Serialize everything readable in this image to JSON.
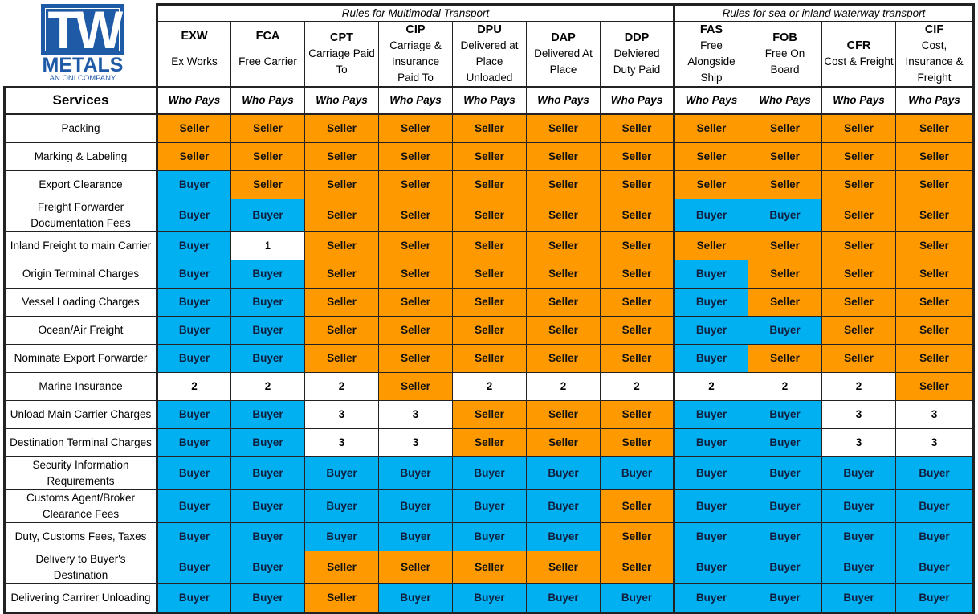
{
  "logo": {
    "mark": "TW",
    "name": "METALS",
    "tagline": "AN ONI COMPANY"
  },
  "groups": [
    {
      "label": "Rules for Multimodal Transport",
      "span": 7
    },
    {
      "label": "Rules for sea or inland waterway transport",
      "span": 4
    }
  ],
  "terms": [
    {
      "code": "EXW",
      "name": "Ex Works"
    },
    {
      "code": "FCA",
      "name": "Free Carrier"
    },
    {
      "code": "CPT",
      "name": "Carriage Paid To"
    },
    {
      "code": "CIP",
      "name": "Carriage & Insurance Paid To"
    },
    {
      "code": "DPU",
      "name": "Delivered at Place Unloaded"
    },
    {
      "code": "DAP",
      "name": "Delivered At Place"
    },
    {
      "code": "DDP",
      "name": "Delviered Duty Paid"
    },
    {
      "code": "FAS",
      "name": "Free Alongside Ship"
    },
    {
      "code": "FOB",
      "name": "Free On Board"
    },
    {
      "code": "CFR",
      "name": "Cost & Freight"
    },
    {
      "code": "CIF",
      "name": "Cost, Insurance & Freight"
    }
  ],
  "services_header": "Services",
  "who_pays_label": "Who Pays",
  "colors": {
    "seller": "#ff9900",
    "buyer": "#00b0f0",
    "blank": "#ffffff"
  },
  "rows": [
    {
      "service": "Packing",
      "values": [
        "Seller",
        "Seller",
        "Seller",
        "Seller",
        "Seller",
        "Seller",
        "Seller",
        "Seller",
        "Seller",
        "Seller",
        "Seller"
      ]
    },
    {
      "service": "Marking & Labeling",
      "values": [
        "Seller",
        "Seller",
        "Seller",
        "Seller",
        "Seller",
        "Seller",
        "Seller",
        "Seller",
        "Seller",
        "Seller",
        "Seller"
      ]
    },
    {
      "service": "Export Clearance",
      "values": [
        "Buyer",
        "Seller",
        "Seller",
        "Seller",
        "Seller",
        "Seller",
        "Seller",
        "Seller",
        "Seller",
        "Seller",
        "Seller"
      ]
    },
    {
      "service": "Freight Forwarder Documentation Fees",
      "values": [
        "Buyer",
        "Buyer",
        "Seller",
        "Seller",
        "Seller",
        "Seller",
        "Seller",
        "Buyer",
        "Buyer",
        "Seller",
        "Seller"
      ]
    },
    {
      "service": "Inland Freight to main Carrier",
      "values": [
        "Buyer",
        "1",
        "Seller",
        "Seller",
        "Seller",
        "Seller",
        "Seller",
        "Seller",
        "Seller",
        "Seller",
        "Seller"
      ]
    },
    {
      "service": "Origin Terminal Charges",
      "values": [
        "Buyer",
        "Buyer",
        "Seller",
        "Seller",
        "Seller",
        "Seller",
        "Seller",
        "Buyer",
        "Seller",
        "Seller",
        "Seller"
      ]
    },
    {
      "service": "Vessel Loading Charges",
      "values": [
        "Buyer",
        "Buyer",
        "Seller",
        "Seller",
        "Seller",
        "Seller",
        "Seller",
        "Buyer",
        "Seller",
        "Seller",
        "Seller"
      ]
    },
    {
      "service": "Ocean/Air Freight",
      "values": [
        "Buyer",
        "Buyer",
        "Seller",
        "Seller",
        "Seller",
        "Seller",
        "Seller",
        "Buyer",
        "Buyer",
        "Seller",
        "Seller"
      ]
    },
    {
      "service": "Nominate Export Forwarder",
      "values": [
        "Buyer",
        "Buyer",
        "Seller",
        "Seller",
        "Seller",
        "Seller",
        "Seller",
        "Buyer",
        "Seller",
        "Seller",
        "Seller"
      ]
    },
    {
      "service": "Marine Insurance",
      "values": [
        "2",
        "2",
        "2",
        "Seller",
        "2",
        "2",
        "2",
        "2",
        "2",
        "2",
        "Seller"
      ]
    },
    {
      "service": "Unload Main Carrier Charges",
      "values": [
        "Buyer",
        "Buyer",
        "3",
        "3",
        "Seller",
        "Seller",
        "Seller",
        "Buyer",
        "Buyer",
        "3",
        "3"
      ]
    },
    {
      "service": "Destination Terminal Charges",
      "values": [
        "Buyer",
        "Buyer",
        "3",
        "3",
        "Seller",
        "Seller",
        "Seller",
        "Buyer",
        "Buyer",
        "3",
        "3"
      ]
    },
    {
      "service": "Security Information Requirements",
      "values": [
        "Buyer",
        "Buyer",
        "Buyer",
        "Buyer",
        "Buyer",
        "Buyer",
        "Buyer",
        "Buyer",
        "Buyer",
        "Buyer",
        "Buyer"
      ]
    },
    {
      "service": "Customs Agent/Broker Clearance Fees",
      "values": [
        "Buyer",
        "Buyer",
        "Buyer",
        "Buyer",
        "Buyer",
        "Buyer",
        "Seller",
        "Buyer",
        "Buyer",
        "Buyer",
        "Buyer"
      ]
    },
    {
      "service": "Duty, Customs Fees, Taxes",
      "values": [
        "Buyer",
        "Buyer",
        "Buyer",
        "Buyer",
        "Buyer",
        "Buyer",
        "Seller",
        "Buyer",
        "Buyer",
        "Buyer",
        "Buyer"
      ]
    },
    {
      "service": "Delivery to Buyer's Destination",
      "values": [
        "Buyer",
        "Buyer",
        "Seller",
        "Seller",
        "Seller",
        "Seller",
        "Seller",
        "Buyer",
        "Buyer",
        "Buyer",
        "Buyer"
      ]
    },
    {
      "service": "Delivering Carrirer Unloading",
      "values": [
        "Buyer",
        "Buyer",
        "Seller",
        "Buyer",
        "Buyer",
        "Buyer",
        "Buyer",
        "Buyer",
        "Buyer",
        "Buyer",
        "Buyer"
      ]
    }
  ]
}
